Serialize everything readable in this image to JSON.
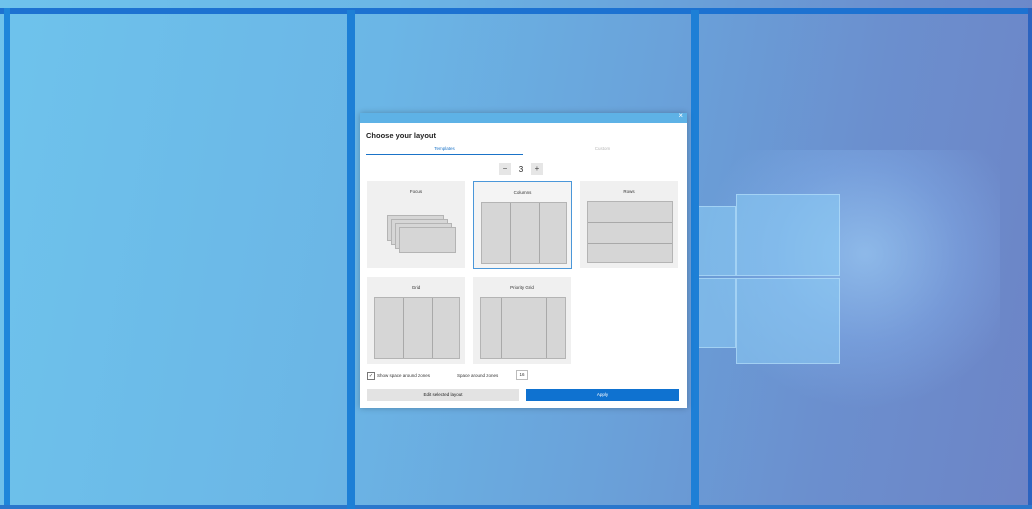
{
  "dialog": {
    "title": "Choose your layout",
    "close_glyph": "×",
    "tabs": [
      {
        "label": "Templates",
        "active": true
      },
      {
        "label": "Custom",
        "active": false
      }
    ],
    "zone_count": {
      "minus": "−",
      "value": "3",
      "plus": "+"
    },
    "layouts": [
      {
        "label": "Focus",
        "selected": false
      },
      {
        "label": "Columns",
        "selected": true
      },
      {
        "label": "Rows",
        "selected": false
      },
      {
        "label": "Grid",
        "selected": false
      },
      {
        "label": "Priority Grid",
        "selected": false
      }
    ],
    "options": {
      "checkbox_mark": "✓",
      "show_space_label": "Show space around zones",
      "space_label": "Space around zones",
      "space_value": "16"
    },
    "buttons": {
      "edit_label": "Edit selected layout",
      "apply_label": "Apply"
    }
  },
  "colors": {
    "accent": "#0f72d0",
    "zone_border": "#1d7fd6"
  }
}
